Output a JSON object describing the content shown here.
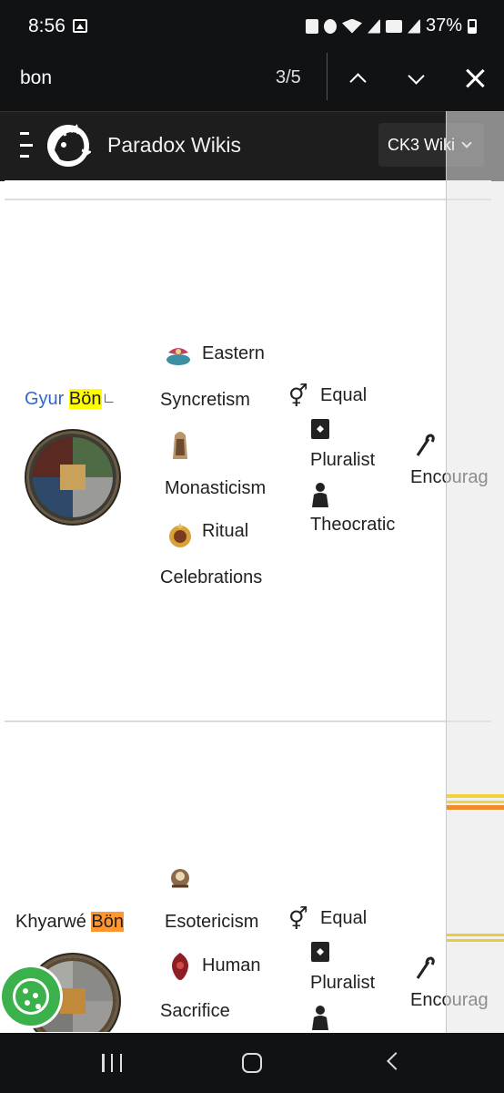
{
  "status_bar": {
    "time": "8:56",
    "battery": "37%"
  },
  "find_bar": {
    "query": "bon",
    "match_count": "3/5"
  },
  "site_header": {
    "title": "Paradox Wikis",
    "wiki_switcher": "CK3 Wiki"
  },
  "table": {
    "rows": [
      {
        "name_prefix": "Gyur ",
        "name_match": "Bön",
        "tenets": [
          {
            "icon": "syncretism-icon",
            "label_line1": "Eastern",
            "label_line2": "Syncretism"
          },
          {
            "icon": "monasticism-icon",
            "label_line1": "",
            "label_line2": "Monasticism"
          },
          {
            "icon": "ritual-celebrations-icon",
            "label_line1": "Ritual",
            "label_line2": "Celebrations"
          }
        ],
        "doctrines": [
          {
            "icon": "gender-icon",
            "label": "Equal"
          },
          {
            "icon": "pluralism-book-icon",
            "label": "Pluralist"
          },
          {
            "icon": "clergy-person-icon",
            "label": "Theocratic"
          }
        ],
        "extra": "Encourag"
      },
      {
        "name_prefix": "Khyarwé ",
        "name_match": "Bön",
        "tenets": [
          {
            "icon": "esotericism-icon",
            "label_line1": "",
            "label_line2": "Esotericism"
          },
          {
            "icon": "human-sacrifice-icon",
            "label_line1": "Human",
            "label_line2": "Sacrifice"
          }
        ],
        "doctrines": [
          {
            "icon": "gender-icon",
            "label": "Equal"
          },
          {
            "icon": "pluralism-book-icon",
            "label": "Pluralist"
          },
          {
            "icon": "clergy-person-icon",
            "label": ""
          }
        ],
        "extra": "Encourag"
      }
    ]
  },
  "colors": {
    "link": "#3366cc",
    "current_match": "#ff9632",
    "other_match": "#ffff00",
    "cookie": "#3ab14a"
  }
}
